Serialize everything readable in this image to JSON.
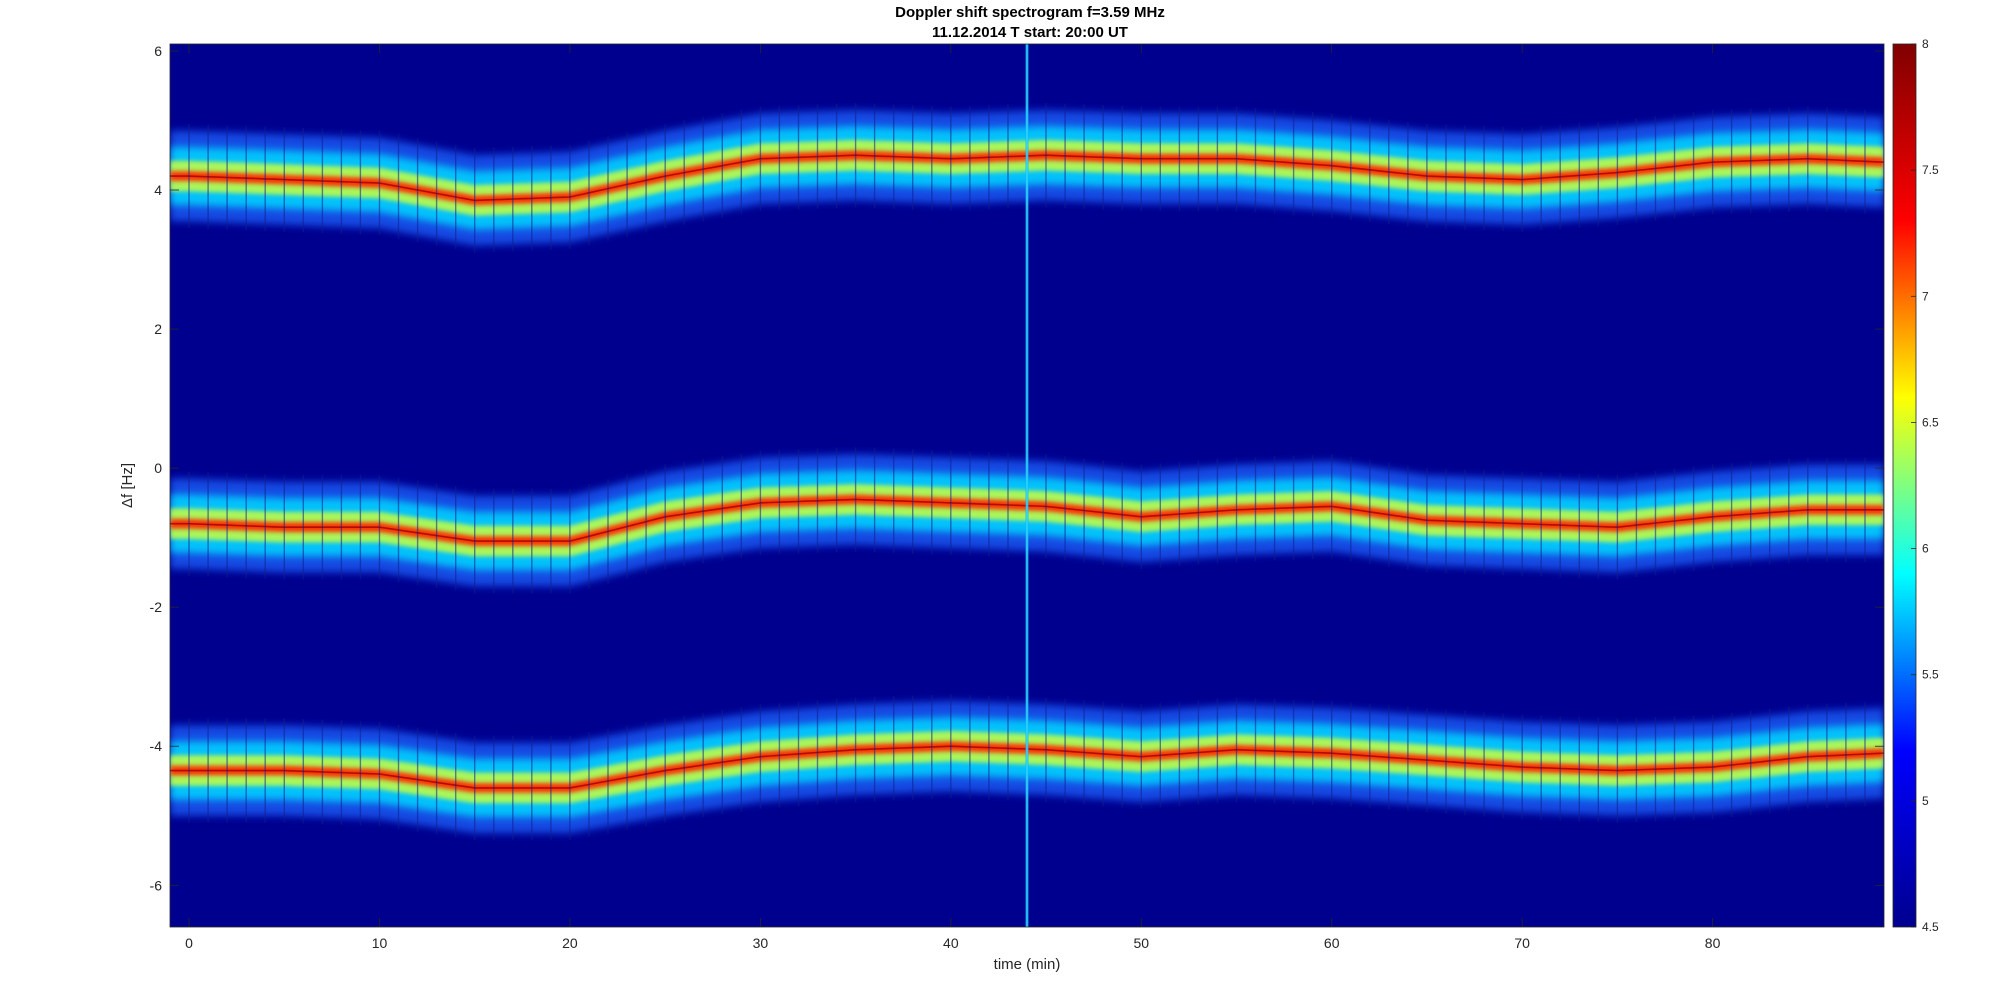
{
  "chart_data": {
    "type": "heatmap",
    "title": "Doppler shift spectrogram f=3.59 MHz",
    "subtitle": "11.12.2014   T start: 20:00 UT",
    "xlabel": "time (min)",
    "ylabel": "Δf [Hz]",
    "xlim": [
      -1,
      89
    ],
    "ylim": [
      -6.6,
      6.1
    ],
    "x_ticks": [
      0,
      10,
      20,
      30,
      40,
      50,
      60,
      70,
      80
    ],
    "y_ticks": [
      -6,
      -4,
      -2,
      0,
      2,
      4,
      6
    ],
    "colorbar": {
      "colormap": "jet",
      "range": [
        4.5,
        8
      ],
      "ticks": [
        4.5,
        5,
        5.5,
        6,
        6.5,
        7,
        7.5,
        8
      ],
      "colors": [
        "#00008f",
        "#0000ff",
        "#00ffff",
        "#ffff00",
        "#ff0000",
        "#800000"
      ]
    },
    "background_color": "#00008f",
    "series": [
      {
        "x": [
          0,
          5,
          10,
          15,
          20,
          25,
          30,
          35,
          40,
          45,
          50,
          55,
          60,
          65,
          70,
          75,
          80,
          85,
          89
        ],
        "values": [
          4.2,
          4.15,
          4.1,
          3.85,
          3.9,
          4.2,
          4.45,
          4.5,
          4.45,
          4.5,
          4.45,
          4.45,
          4.35,
          4.2,
          4.15,
          4.25,
          4.4,
          4.45,
          4.4
        ]
      },
      {
        "x": [
          0,
          5,
          10,
          15,
          20,
          25,
          30,
          35,
          40,
          45,
          50,
          55,
          60,
          65,
          70,
          75,
          80,
          85,
          89
        ],
        "values": [
          -0.8,
          -0.85,
          -0.85,
          -1.05,
          -1.05,
          -0.7,
          -0.5,
          -0.45,
          -0.5,
          -0.55,
          -0.7,
          -0.6,
          -0.55,
          -0.75,
          -0.8,
          -0.85,
          -0.7,
          -0.6,
          -0.6
        ]
      },
      {
        "x": [
          0,
          5,
          10,
          15,
          20,
          25,
          30,
          35,
          40,
          45,
          50,
          55,
          60,
          65,
          70,
          75,
          80,
          85,
          89
        ],
        "values": [
          -4.35,
          -4.35,
          -4.4,
          -4.6,
          -4.6,
          -4.35,
          -4.15,
          -4.05,
          -4.0,
          -4.05,
          -4.15,
          -4.05,
          -4.1,
          -4.2,
          -4.3,
          -4.35,
          -4.3,
          -4.15,
          -4.1
        ]
      }
    ],
    "vertical_artifact_x": 44
  }
}
